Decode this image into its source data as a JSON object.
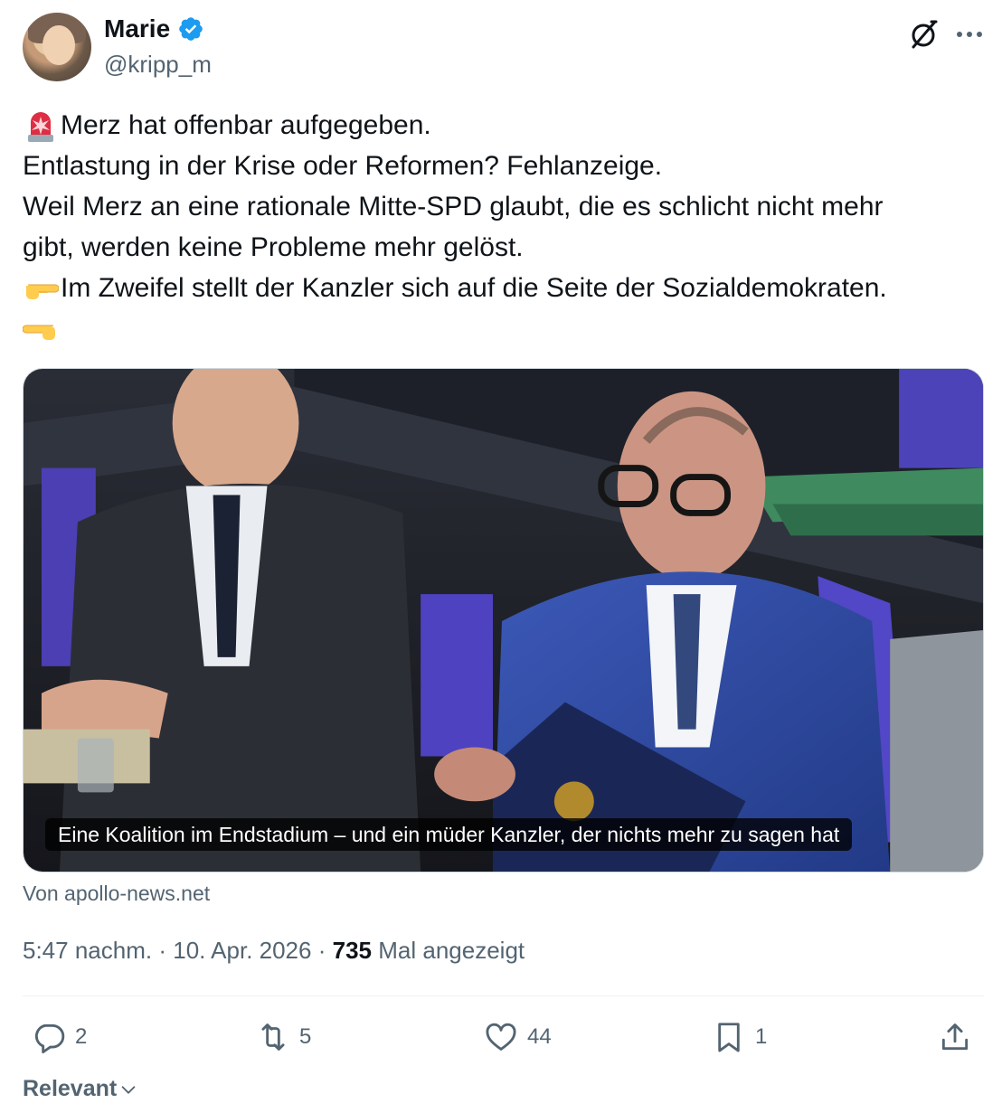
{
  "author": {
    "name": "Marie",
    "handle": "@kripp_m",
    "verified": true,
    "verified_color": "#1d9bf0"
  },
  "header_icons": {
    "grok": "grok-icon",
    "more": "more-icon"
  },
  "tweet": {
    "lines": [
      {
        "emoji": "rotating-light-emoji",
        "text": "Merz hat offenbar aufgegeben."
      },
      {
        "text": "Entlastung in der Krise oder Reformen? Fehlanzeige."
      },
      {
        "text": "Weil Merz an eine rationale Mitte-SPD glaubt, die es schlicht nicht mehr"
      },
      {
        "text": "gibt, werden keine Probleme mehr gelöst."
      },
      {
        "emoji": "pointing-right-emoji",
        "text": "Im Zweifel stellt der Kanzler sich auf die Seite der   Sozialdemokraten."
      },
      {
        "emoji": "pointing-left-emoji",
        "text": ""
      }
    ]
  },
  "card": {
    "caption": "Eine Koalition im Endstadium – und ein müder Kanzler, der nichts mehr zu sagen hat",
    "source": "Von apollo-news.net"
  },
  "meta": {
    "time": "5:47 nachm.",
    "separator": "·",
    "date": "10. Apr. 2026",
    "views_count": "735",
    "views_label": "Mal angezeigt"
  },
  "actions": {
    "replies": "2",
    "reposts": "5",
    "likes": "44",
    "bookmarks": "1"
  },
  "sort": {
    "label": "Relevant"
  }
}
